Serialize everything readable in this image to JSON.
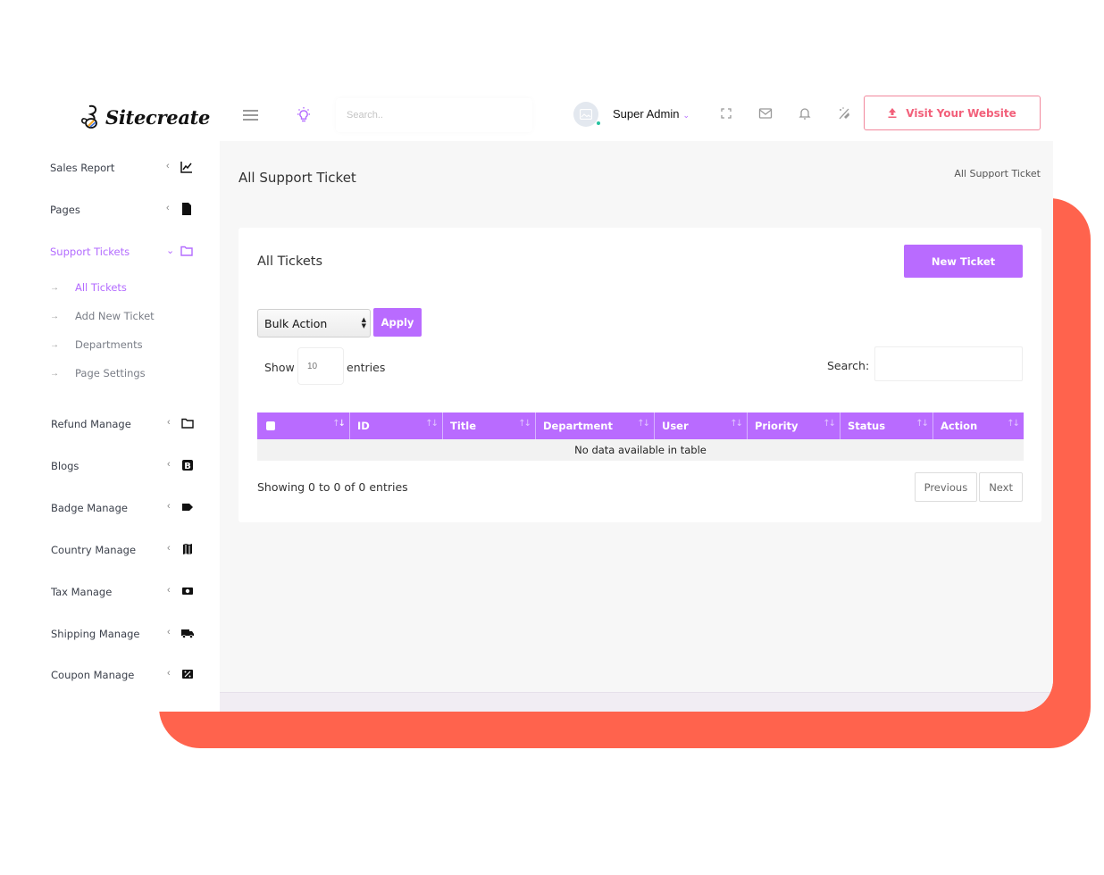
{
  "brand": {
    "name": "Sitecreate"
  },
  "topbar": {
    "search_placeholder": "Search..",
    "user_name": "Super Admin",
    "visit_label": "Visit Your Website",
    "icons": [
      "menu-icon",
      "bulb-icon",
      "fullscreen-icon",
      "mail-icon",
      "bell-icon",
      "clear-cache-icon",
      "upload-icon"
    ]
  },
  "colors": {
    "accent": "#b96bff",
    "visit": "#f2607a",
    "backdrop": "#ff634d",
    "online": "#25c2a0"
  },
  "sidebar": {
    "items": [
      {
        "label": "Sales Report",
        "icon": "chart-line-icon"
      },
      {
        "label": "Pages",
        "icon": "file-icon"
      },
      {
        "label": "Support Tickets",
        "icon": "folder-icon",
        "active": true
      },
      {
        "label": "Refund Manage",
        "icon": "folder-icon"
      },
      {
        "label": "Blogs",
        "icon": "blogger-icon"
      },
      {
        "label": "Badge Manage",
        "icon": "tag-icon"
      },
      {
        "label": "Country Manage",
        "icon": "map-icon"
      },
      {
        "label": "Tax Manage",
        "icon": "money-icon"
      },
      {
        "label": "Shipping Manage",
        "icon": "truck-icon"
      },
      {
        "label": "Coupon Manage",
        "icon": "coupon-icon"
      }
    ],
    "sub_items": [
      {
        "label": "All Tickets",
        "active": true
      },
      {
        "label": "Add New Ticket"
      },
      {
        "label": "Departments"
      },
      {
        "label": "Page Settings"
      }
    ]
  },
  "main": {
    "page_title": "All Support Ticket",
    "breadcrumb": "All Support Ticket",
    "card_title": "All Tickets",
    "new_ticket_label": "New Ticket",
    "bulk_action": "Bulk Action",
    "apply_label": "Apply",
    "show_label": "Show",
    "entries_placeholder": "10",
    "entries_label": "entries",
    "search_label": "Search:",
    "table": {
      "columns": [
        "",
        "ID",
        "Title",
        "Department",
        "User",
        "Priority",
        "Status",
        "Action"
      ],
      "empty_message": "No data available in table"
    },
    "showing": "Showing 0 to 0 of 0 entries",
    "pager": {
      "previous": "Previous",
      "next": "Next"
    }
  }
}
